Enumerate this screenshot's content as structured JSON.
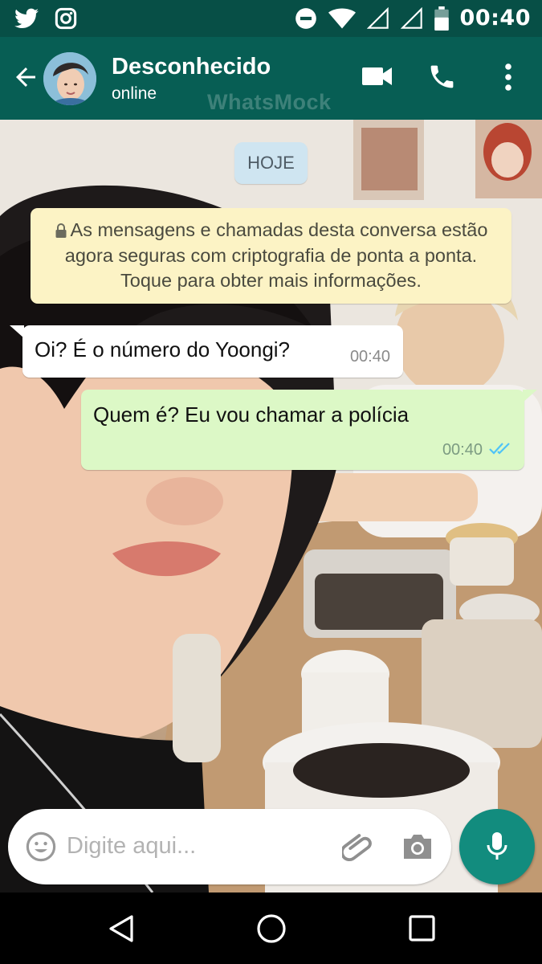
{
  "status_bar": {
    "time": "00:40",
    "left_icons": [
      "twitter-icon",
      "instagram-icon"
    ],
    "right_icons": [
      "do-not-disturb-icon",
      "wifi-icon",
      "signal-icon",
      "signal-icon",
      "battery-icon"
    ]
  },
  "header": {
    "contact_name": "Desconhecido",
    "contact_status": "online",
    "watermark": "WhatsMock",
    "icons": [
      "back-arrow-icon",
      "video-call-icon",
      "phone-icon",
      "more-vert-icon"
    ]
  },
  "chat": {
    "date_chip": "HOJE",
    "system_message": "As mensagens e chamadas desta conversa estão agora seguras com criptografia de ponta a ponta. Toque para obter mais informações.",
    "messages": [
      {
        "direction": "incoming",
        "text": "Oi? É o número do Yoongi?",
        "time": "00:40"
      },
      {
        "direction": "outgoing",
        "text": "Quem é? Eu vou chamar a polícia",
        "time": "00:40",
        "status": "read"
      }
    ]
  },
  "input": {
    "placeholder": "Digite aqui..."
  },
  "colors": {
    "header": "#075e54",
    "status_bar": "#074f46",
    "outgoing_bubble": "#dcf8c6",
    "system_bubble": "#fcf3c5",
    "mic_button": "#128c7e",
    "read_ticks": "#4fc3f7"
  }
}
